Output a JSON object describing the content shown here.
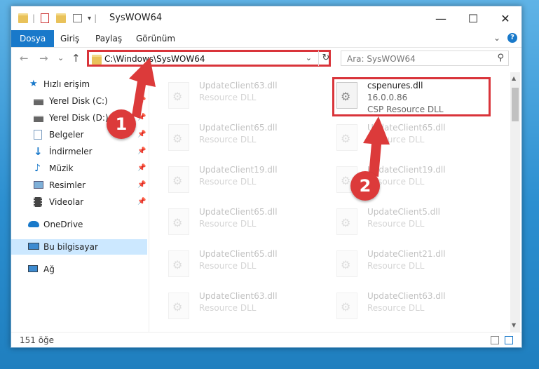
{
  "window": {
    "title": "SysWOW64",
    "minimize": "—",
    "maximize": "☐",
    "close": "✕"
  },
  "ribbon": {
    "tabs": [
      {
        "label": "Dosya",
        "active": true
      },
      {
        "label": "Giriş",
        "active": false
      },
      {
        "label": "Paylaş",
        "active": false
      },
      {
        "label": "Görünüm",
        "active": false
      }
    ],
    "expand": "⌄",
    "help": "?"
  },
  "nav": {
    "back": "←",
    "forward": "→",
    "recent": "⌄",
    "up": "↑",
    "address": "C:\\Windows\\SysWOW64",
    "dropdown": "⌄",
    "refresh": "↻",
    "search_placeholder": "Ara: SysWOW64",
    "search_icon": "⚲"
  },
  "sidebar": {
    "items": [
      {
        "label": "Hızlı erişim",
        "icon": "star-icon",
        "pinned": false
      },
      {
        "label": "Yerel Disk (C:)",
        "icon": "drive-icon",
        "pinned": true
      },
      {
        "label": "Yerel Disk (D:)",
        "icon": "drive-icon",
        "pinned": true
      },
      {
        "label": "Belgeler",
        "icon": "documents-icon",
        "pinned": true
      },
      {
        "label": "İndirmeler",
        "icon": "download-icon",
        "pinned": true
      },
      {
        "label": "Müzik",
        "icon": "music-icon",
        "pinned": true
      },
      {
        "label": "Resimler",
        "icon": "pictures-icon",
        "pinned": true
      },
      {
        "label": "Videolar",
        "icon": "videos-icon",
        "pinned": true
      },
      {
        "label": "OneDrive",
        "icon": "cloud-icon",
        "pinned": false
      },
      {
        "label": "Bu bilgisayar",
        "icon": "computer-icon",
        "pinned": false,
        "selected": true
      },
      {
        "label": "Ağ",
        "icon": "network-icon",
        "pinned": false
      }
    ],
    "pin_glyph": "📌"
  },
  "files": {
    "left_column": [
      {
        "name": "UpdateClient63.dll",
        "type": "Resource DLL"
      },
      {
        "name": "UpdateClient65.dll",
        "type": "Resource DLL"
      },
      {
        "name": "UpdateClient19.dll",
        "type": "Resource DLL"
      },
      {
        "name": "UpdateClient65.dll",
        "type": "Resource DLL"
      },
      {
        "name": "UpdateClient65.dll",
        "type": "Resource DLL"
      },
      {
        "name": "UpdateClient63.dll",
        "type": "Resource DLL"
      }
    ],
    "right_column": [
      {
        "name": "cspenures.dll",
        "version": "16.0.0.86",
        "type": "CSP Resource DLL",
        "highlighted": true
      },
      {
        "name": "UpdateClient65.dll",
        "type": "Resource DLL"
      },
      {
        "name": "UpdateClient19.dll",
        "type": "Resource DLL"
      },
      {
        "name": "UpdateClient5.dll",
        "type": "Resource DLL"
      },
      {
        "name": "UpdateClient21.dll",
        "type": "Resource DLL"
      },
      {
        "name": "UpdateClient63.dll",
        "type": "Resource DLL"
      }
    ]
  },
  "status": {
    "count": "151 öğe"
  },
  "callouts": [
    "1",
    "2"
  ],
  "colors": {
    "accent": "#1979ca",
    "callout": "#dc3a3a",
    "selection": "#cce8ff"
  }
}
